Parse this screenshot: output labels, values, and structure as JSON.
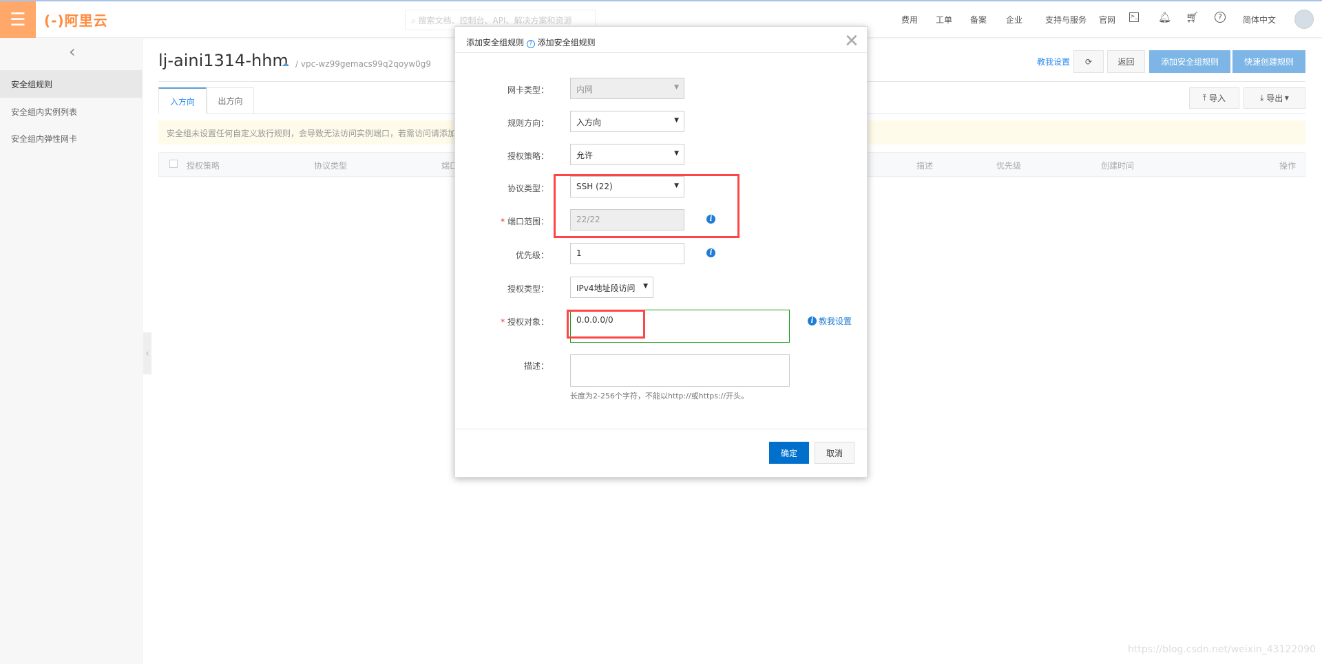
{
  "topbar": {
    "logo": "(-)阿里云",
    "search_placeholder": "搜索文档、控制台、API、解决方案和资源",
    "nav": [
      "费用",
      "工单",
      "备案",
      "企业",
      "支持与服务",
      "官网"
    ],
    "language": "简体中文",
    "icons": [
      "terminal-icon",
      "bell-icon",
      "cart-icon",
      "help-icon"
    ]
  },
  "sidebar": {
    "items": [
      {
        "label": "安全组规则",
        "active": true
      },
      {
        "label": "安全组内实例列表"
      },
      {
        "label": "安全组内弹性网卡"
      }
    ]
  },
  "header": {
    "title": "lj-aini1314-hhm",
    "vpc": "/ vpc-wz99gemacs99q2qoyw0g9",
    "help_link": "教我设置",
    "back": "返回",
    "add_rule": "添加安全组规则",
    "quick_rule": "快速创建规则"
  },
  "tabs": [
    "入方向",
    "出方向"
  ],
  "toolbar": {
    "import": "导入",
    "export": "导出"
  },
  "warning": "安全组未设置任何自定义放行规则，会导致无法访问实例端口，若需访问请添加",
  "table": {
    "columns": [
      "授权策略",
      "协议类型",
      "端口",
      "描述",
      "优先级",
      "创建时间",
      "操作"
    ]
  },
  "dialog": {
    "title": "添加安全组规则",
    "title_help": "添加安全组规则",
    "fields": {
      "nic_type": {
        "label": "网卡类型：",
        "value": "内网"
      },
      "direction": {
        "label": "规则方向：",
        "value": "入方向"
      },
      "policy": {
        "label": "授权策略：",
        "value": "允许"
      },
      "protocol": {
        "label": "协议类型：",
        "value": "SSH (22)"
      },
      "port": {
        "label": "端口范围：",
        "value": "22/22"
      },
      "priority": {
        "label": "优先级：",
        "value": "1"
      },
      "auth_type": {
        "label": "授权类型：",
        "value": "IPv4地址段访问"
      },
      "auth_object": {
        "label": "授权对象：",
        "value": "0.0.0.0/0",
        "help": "教我设置"
      },
      "description": {
        "label": "描述：",
        "value": "",
        "hint": "长度为2-256个字符，不能以http://或https://开头。"
      }
    },
    "required_mark": "*",
    "confirm": "确定",
    "cancel": "取消"
  },
  "watermark": "https://blog.csdn.net/weixin_43122090",
  "colors": {
    "brand": "#ffa86a",
    "primary": "#0070cc",
    "highlight": "#ff4444"
  }
}
